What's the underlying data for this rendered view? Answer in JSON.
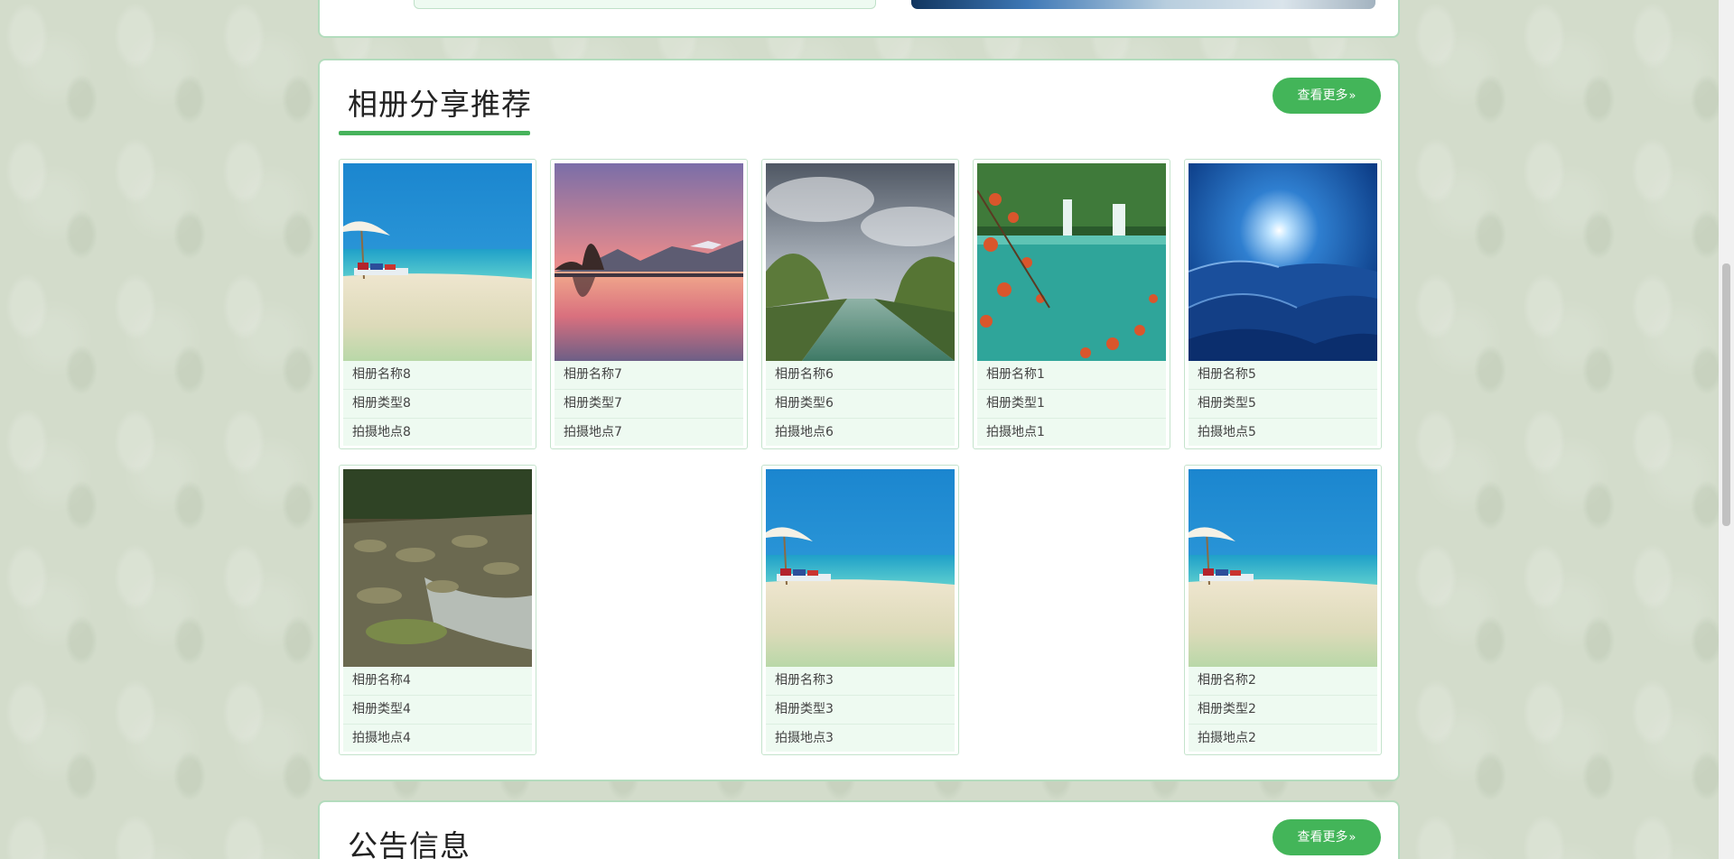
{
  "album_section": {
    "title": "相册分享推荐",
    "more_label": "查看更多",
    "accent_color": "#47b35b",
    "cards": [
      {
        "name": "相册名称8",
        "type": "相册类型8",
        "location": "拍摄地点8",
        "image": "beach"
      },
      {
        "name": "相册名称7",
        "type": "相册类型7",
        "location": "拍摄地点7",
        "image": "sunset-lake"
      },
      {
        "name": "相册名称6",
        "type": "相册类型6",
        "location": "拍摄地点6",
        "image": "river-trees"
      },
      {
        "name": "相册名称1",
        "type": "相册类型1",
        "location": "拍摄地点1",
        "image": "waterfall-lake"
      },
      {
        "name": "相册名称5",
        "type": "相册类型5",
        "location": "拍摄地点5",
        "image": "blue-sun"
      },
      {
        "name": "相册名称4",
        "type": "相册类型4",
        "location": "拍摄地点4",
        "image": "rocky-stream"
      },
      {
        "name": "相册名称3",
        "type": "相册类型3",
        "location": "拍摄地点3",
        "image": "beach"
      },
      {
        "name": "相册名称2",
        "type": "相册类型2",
        "location": "拍摄地点2",
        "image": "beach"
      }
    ]
  },
  "notice_section": {
    "title": "公告信息",
    "more_label": "查看更多"
  }
}
